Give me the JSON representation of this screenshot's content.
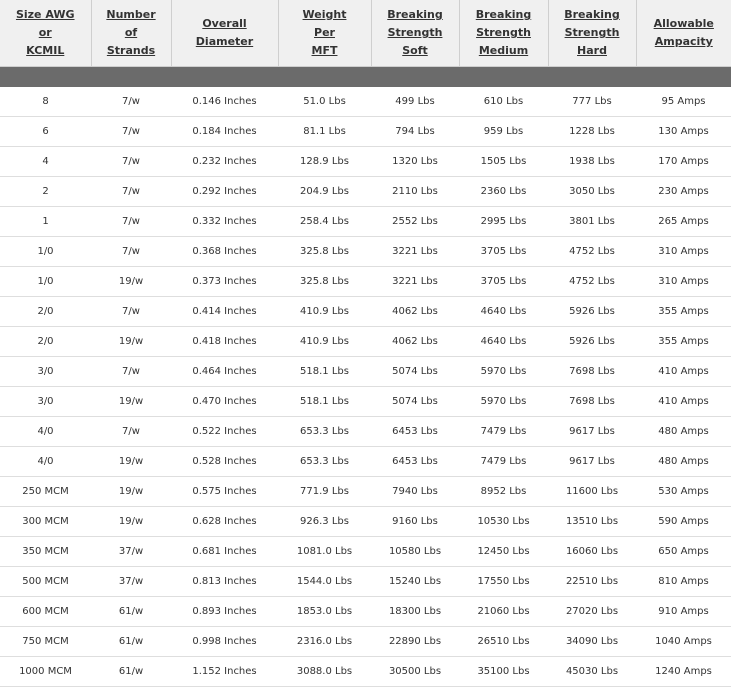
{
  "headers": [
    [
      "Size AWG",
      "or",
      "KCMIL"
    ],
    [
      "Number",
      "of",
      "Strands"
    ],
    [
      "Overall",
      "Diameter"
    ],
    [
      "Weight",
      "Per",
      "MFT"
    ],
    [
      "Breaking",
      "Strength",
      "Soft"
    ],
    [
      "Breaking",
      "Strength",
      "Medium"
    ],
    [
      "Breaking",
      "Strength",
      "Hard"
    ],
    [
      "Allowable",
      "Ampacity"
    ]
  ],
  "rows": [
    [
      "8",
      "7/w",
      "0.146 Inches",
      "51.0 Lbs",
      "499 Lbs",
      "610 Lbs",
      "777 Lbs",
      "95 Amps"
    ],
    [
      "6",
      "7/w",
      "0.184 Inches",
      "81.1 Lbs",
      "794 Lbs",
      "959 Lbs",
      "1228 Lbs",
      "130 Amps"
    ],
    [
      "4",
      "7/w",
      "0.232 Inches",
      "128.9 Lbs",
      "1320 Lbs",
      "1505 Lbs",
      "1938 Lbs",
      "170 Amps"
    ],
    [
      "2",
      "7/w",
      "0.292 Inches",
      "204.9 Lbs",
      "2110 Lbs",
      "2360 Lbs",
      "3050 Lbs",
      "230 Amps"
    ],
    [
      "1",
      "7/w",
      "0.332 Inches",
      "258.4 Lbs",
      "2552 Lbs",
      "2995 Lbs",
      "3801 Lbs",
      "265 Amps"
    ],
    [
      "1/0",
      "7/w",
      "0.368 Inches",
      "325.8 Lbs",
      "3221 Lbs",
      "3705 Lbs",
      "4752 Lbs",
      "310 Amps"
    ],
    [
      "1/0",
      "19/w",
      "0.373 Inches",
      "325.8 Lbs",
      "3221 Lbs",
      "3705 Lbs",
      "4752 Lbs",
      "310 Amps"
    ],
    [
      "2/0",
      "7/w",
      "0.414 Inches",
      "410.9 Lbs",
      "4062 Lbs",
      "4640 Lbs",
      "5926 Lbs",
      "355 Amps"
    ],
    [
      "2/0",
      "19/w",
      "0.418 Inches",
      "410.9 Lbs",
      "4062 Lbs",
      "4640 Lbs",
      "5926 Lbs",
      "355 Amps"
    ],
    [
      "3/0",
      "7/w",
      "0.464 Inches",
      "518.1 Lbs",
      "5074 Lbs",
      "5970 Lbs",
      "7698 Lbs",
      "410 Amps"
    ],
    [
      "3/0",
      "19/w",
      "0.470 Inches",
      "518.1 Lbs",
      "5074 Lbs",
      "5970 Lbs",
      "7698 Lbs",
      "410 Amps"
    ],
    [
      "4/0",
      "7/w",
      "0.522 Inches",
      "653.3 Lbs",
      "6453 Lbs",
      "7479 Lbs",
      "9617 Lbs",
      "480 Amps"
    ],
    [
      "4/0",
      "19/w",
      "0.528 Inches",
      "653.3 Lbs",
      "6453 Lbs",
      "7479 Lbs",
      "9617 Lbs",
      "480 Amps"
    ],
    [
      "250 MCM",
      "19/w",
      "0.575 Inches",
      "771.9 Lbs",
      "7940 Lbs",
      "8952 Lbs",
      "11600 Lbs",
      "530 Amps"
    ],
    [
      "300 MCM",
      "19/w",
      "0.628 Inches",
      "926.3 Lbs",
      "9160 Lbs",
      "10530 Lbs",
      "13510 Lbs",
      "590 Amps"
    ],
    [
      "350 MCM",
      "37/w",
      "0.681 Inches",
      "1081.0 Lbs",
      "10580 Lbs",
      "12450 Lbs",
      "16060 Lbs",
      "650 Amps"
    ],
    [
      "500 MCM",
      "37/w",
      "0.813 Inches",
      "1544.0 Lbs",
      "15240 Lbs",
      "17550 Lbs",
      "22510 Lbs",
      "810 Amps"
    ],
    [
      "600 MCM",
      "61/w",
      "0.893 Inches",
      "1853.0 Lbs",
      "18300 Lbs",
      "21060 Lbs",
      "27020 Lbs",
      "910 Amps"
    ],
    [
      "750 MCM",
      "61/w",
      "0.998 Inches",
      "2316.0 Lbs",
      "22890 Lbs",
      "26510 Lbs",
      "34090 Lbs",
      "1040 Amps"
    ],
    [
      "1000 MCM",
      "61/w",
      "1.152 Inches",
      "3088.0 Lbs",
      "30500 Lbs",
      "35100 Lbs",
      "45030 Lbs",
      "1240 Amps"
    ]
  ],
  "colors": {
    "header_bg": "#f0f0f0",
    "band": "#6b6b6b",
    "row_border": "#dedede",
    "text": "#333333"
  }
}
